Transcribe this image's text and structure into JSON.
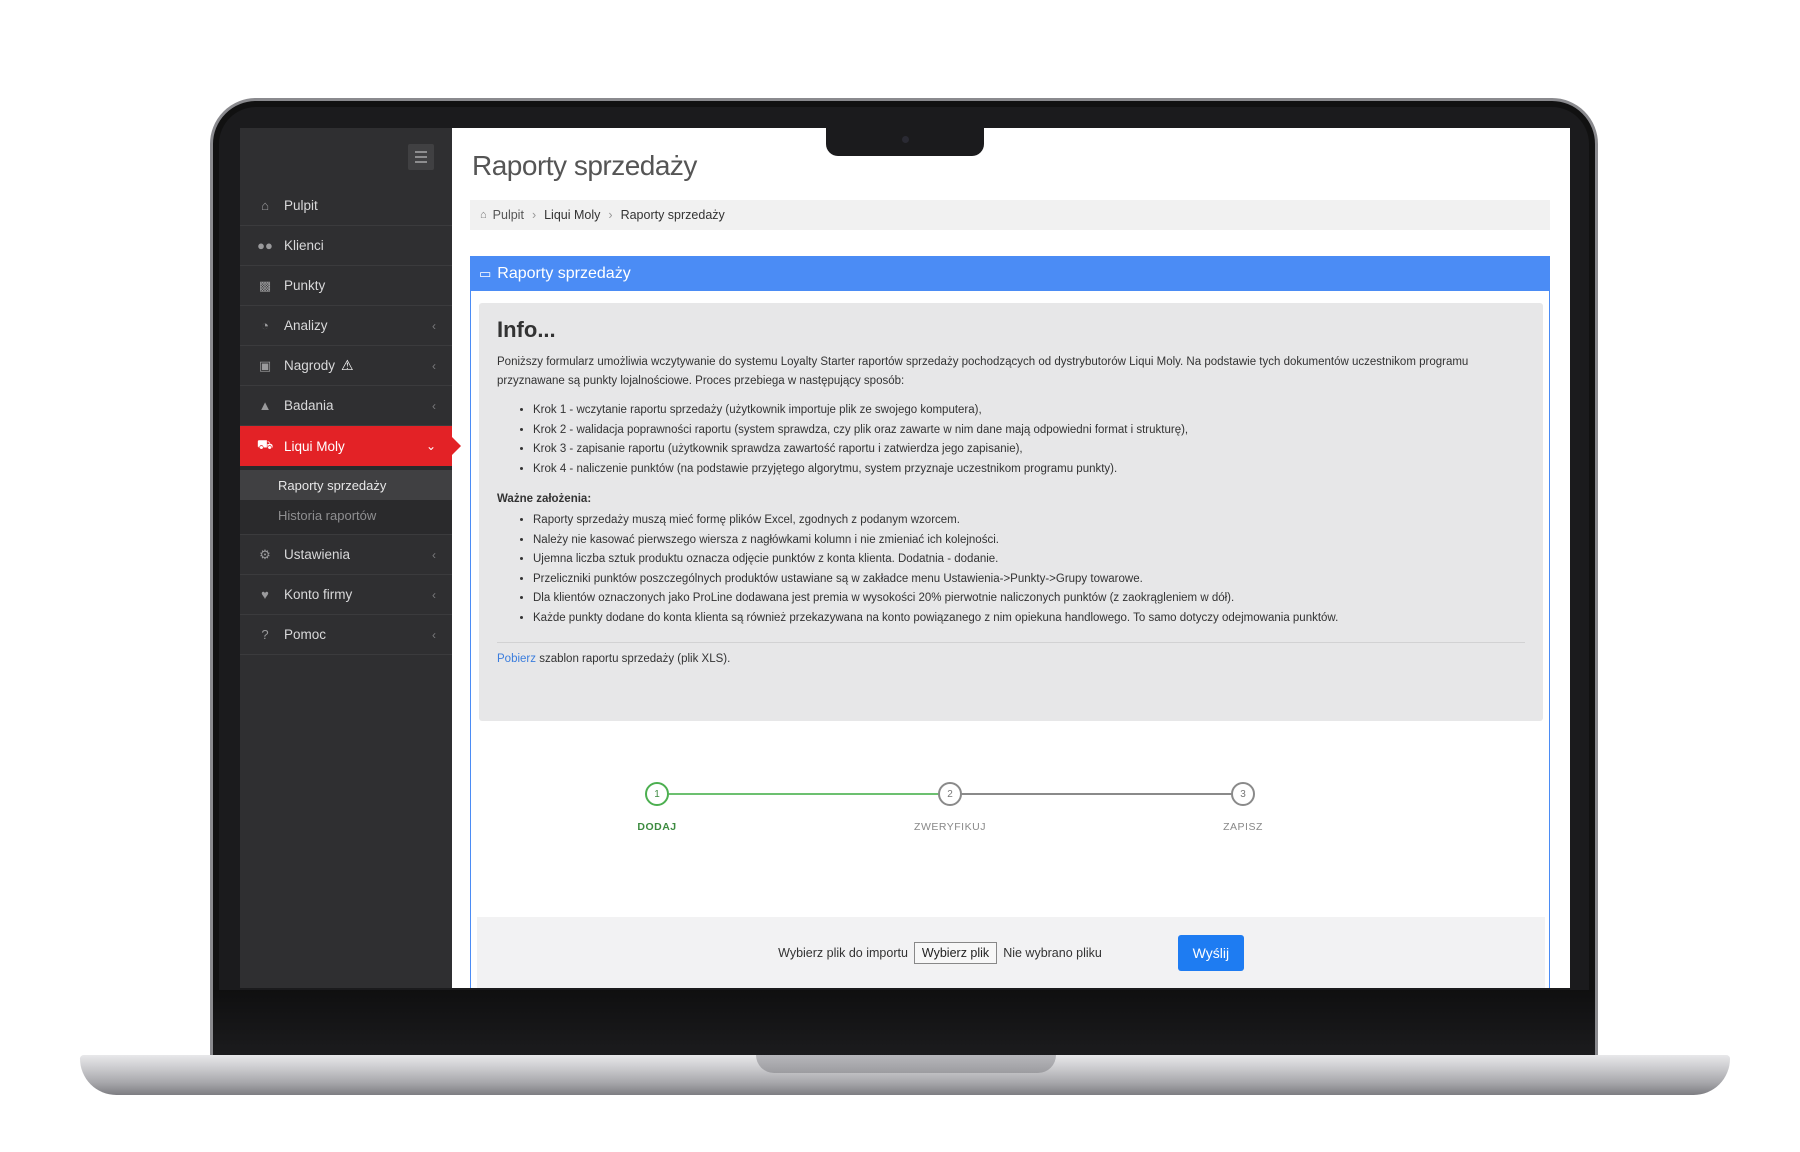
{
  "sidebar": {
    "items": [
      {
        "label": "Pulpit",
        "icon": "home-icon"
      },
      {
        "label": "Klienci",
        "icon": "users-icon"
      },
      {
        "label": "Punkty",
        "icon": "bar-chart-icon"
      },
      {
        "label": "Analizy",
        "icon": "pie-chart-icon"
      },
      {
        "label": "Nagrody",
        "icon": "gift-icon"
      },
      {
        "label": "Badania",
        "icon": "flask-icon"
      },
      {
        "label": "Liqui Moly",
        "icon": "car-icon"
      },
      {
        "label": "Ustawienia",
        "icon": "gear-icon"
      },
      {
        "label": "Konto firmy",
        "icon": "heart-icon"
      },
      {
        "label": "Pomoc",
        "icon": "question-icon"
      }
    ],
    "submenu": [
      "Raporty sprzedaży",
      "Historia raportów"
    ],
    "active_color": "#e32226"
  },
  "page": {
    "title": "Raporty sprzedaży"
  },
  "breadcrumb": [
    "Pulpit",
    "Liqui Moly",
    "Raporty sprzedaży"
  ],
  "panel": {
    "title": "Raporty sprzedaży",
    "header_color": "#4b8cf5"
  },
  "info": {
    "title": "Info...",
    "intro": "Poniższy formularz umożliwia wczytywanie do systemu Loyalty Starter raportów sprzedaży pochodzących od dystrybutorów Liqui Moly. Na podstawie tych dokumentów uczestnikom programu przyznawane są punkty lojalnościowe. Proces przebiega w następujący sposób:",
    "steps": [
      "Krok 1 - wczytanie raportu sprzedaży (użytkownik importuje plik ze swojego komputera),",
      "Krok 2 - walidacja poprawności raportu (system sprawdza, czy plik oraz zawarte w nim dane mają odpowiedni format i strukturę),",
      "Krok 3 - zapisanie raportu (użytkownik sprawdza zawartość raportu i zatwierdza jego zapisanie),",
      "Krok 4 - naliczenie punktów (na podstawie przyjętego algorytmu, system przyznaje uczestnikom programu punkty)."
    ],
    "rules_title": "Ważne założenia:",
    "rules": [
      "Raporty sprzedaży muszą mieć formę plików Excel, zgodnych z podanym wzorcem.",
      "Należy nie kasować pierwszego wiersza z nagłówkami kolumn i nie zmieniać ich kolejności.",
      "Ujemna liczba sztuk produktu oznacza odjęcie punktów z konta klienta. Dodatnia - dodanie.",
      "Przeliczniki punktów poszczególnych produktów ustawiane są w zakładce menu Ustawienia->Punkty->Grupy towarowe.",
      "Dla klientów oznaczonych jako ProLine dodawana jest premia w wysokości 20% pierwotnie naliczonych punktów (z zaokrągleniem w dół).",
      "Każde punkty dodane do konta klienta są również przekazywana na konto powiązanego z nim opiekuna handlowego. To samo dotyczy odejmowania punktów."
    ],
    "download_link": "Pobierz",
    "download_text": "szablon raportu sprzedaży (plik XLS)."
  },
  "stepper": {
    "steps": [
      {
        "number": "1",
        "label": "DODAJ"
      },
      {
        "number": "2",
        "label": "ZWERYFIKUJ"
      },
      {
        "number": "3",
        "label": "ZAPISZ"
      }
    ],
    "done_color": "#4caf50"
  },
  "upload": {
    "label": "Wybierz plik do importu",
    "choose_button": "Wybierz plik",
    "no_file_text": "Nie wybrano pliku",
    "submit_button": "Wyślij",
    "submit_color": "#1e7cf2"
  }
}
